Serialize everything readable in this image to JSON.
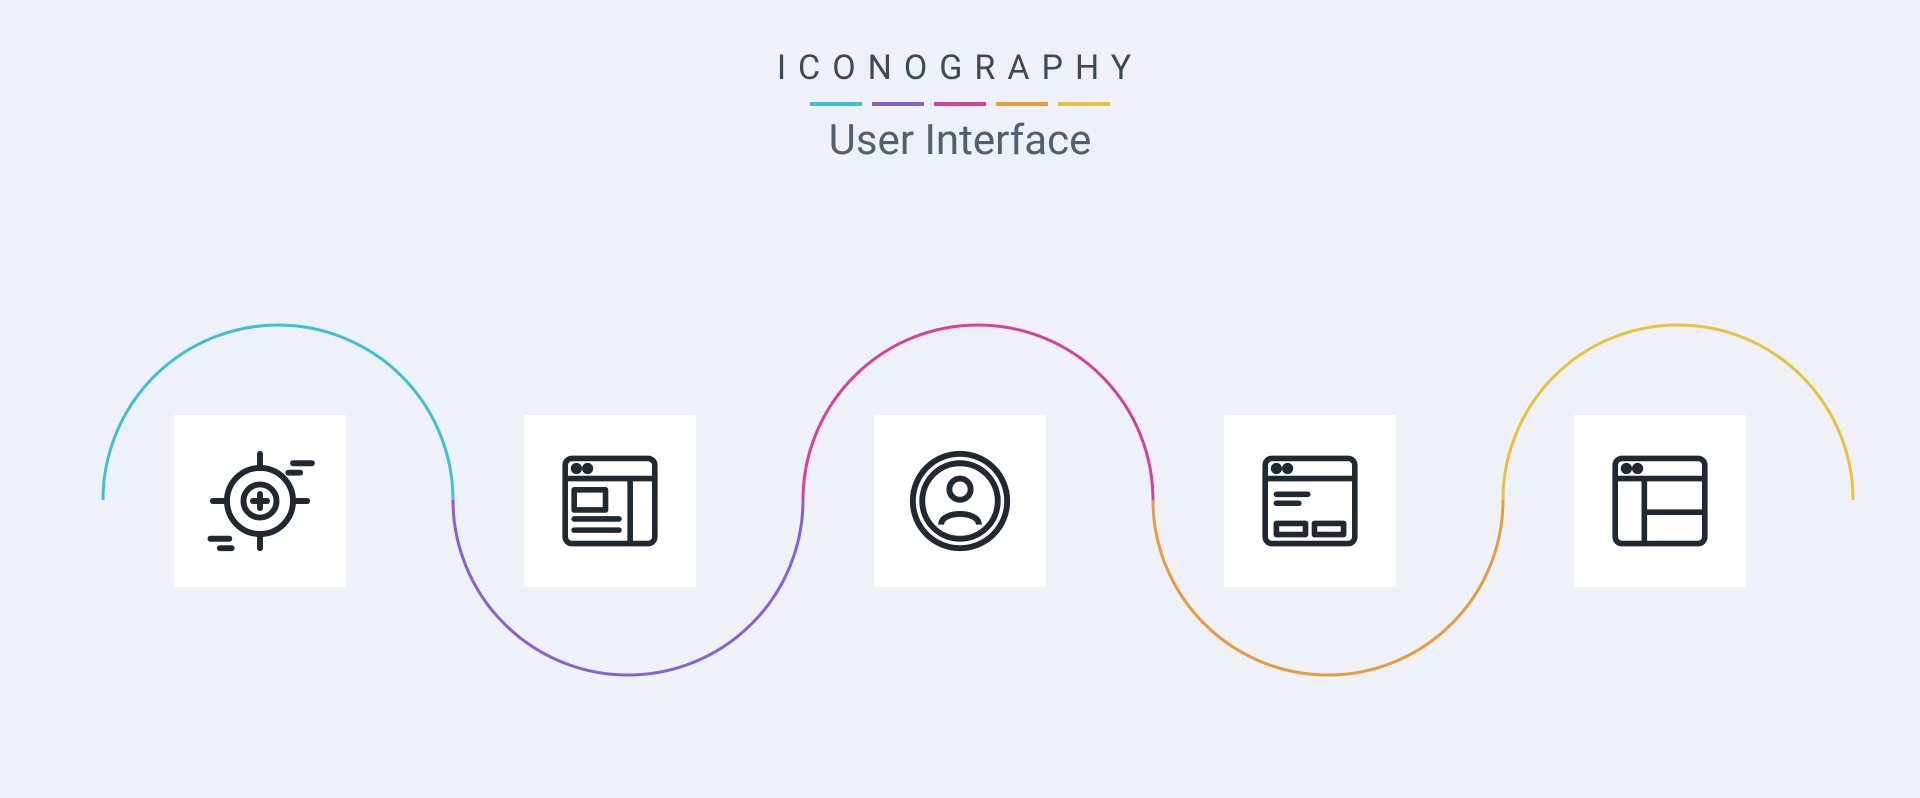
{
  "header": {
    "title": "ICONOGRAPHY",
    "subtitle": "User Interface"
  },
  "colors": {
    "bg": "#eef1f7",
    "card": "#ffffff",
    "stroke": "#1f2933",
    "accent1": "#3fbfd6",
    "accent2": "#8a5fd6",
    "accent3": "#d63f9a",
    "accent4": "#e89a3f",
    "accent5": "#e8c23f"
  },
  "icons": [
    {
      "name": "target-icon",
      "label": "target / aim"
    },
    {
      "name": "layout-right-icon",
      "label": "layout with right sidebar"
    },
    {
      "name": "user-circle-icon",
      "label": "user in circle"
    },
    {
      "name": "message-window-icon",
      "label": "message window"
    },
    {
      "name": "layout-left-icon",
      "label": "layout with left sidebar"
    }
  ]
}
